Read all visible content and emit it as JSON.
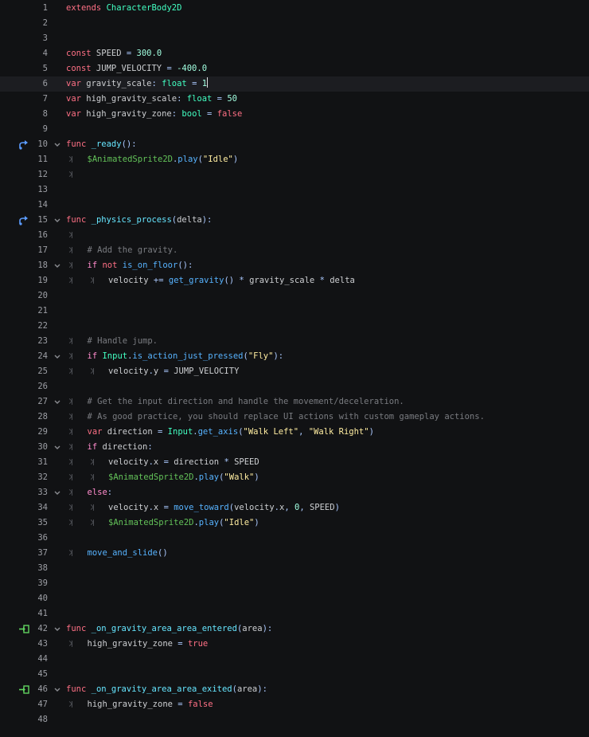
{
  "editor": {
    "line_height": 19,
    "current_line": 6,
    "lines": [
      {
        "n": "1",
        "indent": 0,
        "tokens": [
          [
            "kw",
            "extends"
          ],
          [
            "tx",
            " "
          ],
          [
            "ty",
            "CharacterBody2D"
          ]
        ]
      },
      {
        "n": "2",
        "indent": 0,
        "tokens": []
      },
      {
        "n": "3",
        "indent": 0,
        "tokens": []
      },
      {
        "n": "4",
        "indent": 0,
        "tokens": [
          [
            "kw",
            "const"
          ],
          [
            "tx",
            " SPEED "
          ],
          [
            "sy",
            "="
          ],
          [
            "tx",
            " "
          ],
          [
            "num",
            "300.0"
          ]
        ]
      },
      {
        "n": "5",
        "indent": 0,
        "tokens": [
          [
            "kw",
            "const"
          ],
          [
            "tx",
            " JUMP_VELOCITY "
          ],
          [
            "sy",
            "="
          ],
          [
            "tx",
            " "
          ],
          [
            "num",
            "-400.0"
          ]
        ]
      },
      {
        "n": "6",
        "indent": 0,
        "caret": true,
        "tokens": [
          [
            "kw",
            "var"
          ],
          [
            "tx",
            " gravity_scale"
          ],
          [
            "sy",
            ":"
          ],
          [
            "tx",
            " "
          ],
          [
            "ty",
            "float"
          ],
          [
            "tx",
            " "
          ],
          [
            "sy",
            "="
          ],
          [
            "tx",
            " "
          ],
          [
            "num",
            "1"
          ]
        ]
      },
      {
        "n": "7",
        "indent": 0,
        "tokens": [
          [
            "kw",
            "var"
          ],
          [
            "tx",
            " high_gravity_scale"
          ],
          [
            "sy",
            ":"
          ],
          [
            "tx",
            " "
          ],
          [
            "ty",
            "float"
          ],
          [
            "tx",
            " "
          ],
          [
            "sy",
            "="
          ],
          [
            "tx",
            " "
          ],
          [
            "num",
            "50"
          ]
        ]
      },
      {
        "n": "8",
        "indent": 0,
        "tokens": [
          [
            "kw",
            "var"
          ],
          [
            "tx",
            " high_gravity_zone"
          ],
          [
            "sy",
            ":"
          ],
          [
            "tx",
            " "
          ],
          [
            "ty",
            "bool"
          ],
          [
            "tx",
            " "
          ],
          [
            "sy",
            "="
          ],
          [
            "tx",
            " "
          ],
          [
            "kw",
            "false"
          ]
        ]
      },
      {
        "n": "9",
        "indent": 0,
        "tokens": []
      },
      {
        "n": "10",
        "indent": 0,
        "fold": true,
        "icon": "override-icon",
        "tokens": [
          [
            "kw",
            "func"
          ],
          [
            "tx",
            " "
          ],
          [
            "fd",
            "_ready"
          ],
          [
            "sy",
            "():"
          ]
        ]
      },
      {
        "n": "11",
        "indent": 1,
        "tokens": [
          [
            "nd",
            "$AnimatedSprite2D"
          ],
          [
            "sy",
            "."
          ],
          [
            "fn",
            "play"
          ],
          [
            "sy",
            "("
          ],
          [
            "str",
            "\"Idle\""
          ],
          [
            "sy",
            ")"
          ]
        ]
      },
      {
        "n": "12",
        "indent": 1,
        "tokens": []
      },
      {
        "n": "13",
        "indent": 0,
        "tokens": []
      },
      {
        "n": "14",
        "indent": 0,
        "tokens": []
      },
      {
        "n": "15",
        "indent": 0,
        "fold": true,
        "icon": "override-icon",
        "tokens": [
          [
            "kw",
            "func"
          ],
          [
            "tx",
            " "
          ],
          [
            "fd",
            "_physics_process"
          ],
          [
            "sy",
            "("
          ],
          [
            "tx",
            "delta"
          ],
          [
            "sy",
            "):"
          ]
        ]
      },
      {
        "n": "16",
        "indent": 1,
        "tokens": []
      },
      {
        "n": "17",
        "indent": 1,
        "tokens": [
          [
            "cm",
            "# Add the gravity."
          ]
        ]
      },
      {
        "n": "18",
        "indent": 1,
        "fold": true,
        "tokens": [
          [
            "cf",
            "if"
          ],
          [
            "tx",
            " "
          ],
          [
            "kw",
            "not"
          ],
          [
            "tx",
            " "
          ],
          [
            "fn",
            "is_on_floor"
          ],
          [
            "sy",
            "():"
          ]
        ]
      },
      {
        "n": "19",
        "indent": 2,
        "tokens": [
          [
            "tx",
            "velocity "
          ],
          [
            "sy",
            "+="
          ],
          [
            "tx",
            " "
          ],
          [
            "fn",
            "get_gravity"
          ],
          [
            "sy",
            "()"
          ],
          [
            "tx",
            " "
          ],
          [
            "sy",
            "*"
          ],
          [
            "tx",
            " gravity_scale "
          ],
          [
            "sy",
            "*"
          ],
          [
            "tx",
            " delta"
          ]
        ]
      },
      {
        "n": "20",
        "indent": 0,
        "tokens": []
      },
      {
        "n": "21",
        "indent": 0,
        "tokens": []
      },
      {
        "n": "22",
        "indent": 0,
        "tokens": []
      },
      {
        "n": "23",
        "indent": 1,
        "tokens": [
          [
            "cm",
            "# Handle jump."
          ]
        ]
      },
      {
        "n": "24",
        "indent": 1,
        "fold": true,
        "tokens": [
          [
            "cf",
            "if"
          ],
          [
            "tx",
            " "
          ],
          [
            "ty",
            "Input"
          ],
          [
            "sy",
            "."
          ],
          [
            "fn",
            "is_action_just_pressed"
          ],
          [
            "sy",
            "("
          ],
          [
            "str",
            "\"Fly\""
          ],
          [
            "sy",
            "):"
          ]
        ]
      },
      {
        "n": "25",
        "indent": 2,
        "tokens": [
          [
            "tx",
            "velocity"
          ],
          [
            "sy",
            "."
          ],
          [
            "tx",
            "y "
          ],
          [
            "sy",
            "="
          ],
          [
            "tx",
            " JUMP_VELOCITY"
          ]
        ]
      },
      {
        "n": "26",
        "indent": 0,
        "tokens": []
      },
      {
        "n": "27",
        "indent": 1,
        "fold": true,
        "tokens": [
          [
            "cm",
            "# Get the input direction and handle the movement/deceleration."
          ]
        ]
      },
      {
        "n": "28",
        "indent": 1,
        "tokens": [
          [
            "cm",
            "# As good practice, you should replace UI actions with custom gameplay actions."
          ]
        ]
      },
      {
        "n": "29",
        "indent": 1,
        "tokens": [
          [
            "kw",
            "var"
          ],
          [
            "tx",
            " direction "
          ],
          [
            "sy",
            "="
          ],
          [
            "tx",
            " "
          ],
          [
            "ty",
            "Input"
          ],
          [
            "sy",
            "."
          ],
          [
            "fn",
            "get_axis"
          ],
          [
            "sy",
            "("
          ],
          [
            "str",
            "\"Walk Left\""
          ],
          [
            "sy",
            ","
          ],
          [
            "tx",
            " "
          ],
          [
            "str",
            "\"Walk Right\""
          ],
          [
            "sy",
            ")"
          ]
        ]
      },
      {
        "n": "30",
        "indent": 1,
        "fold": true,
        "tokens": [
          [
            "cf",
            "if"
          ],
          [
            "tx",
            " direction"
          ],
          [
            "sy",
            ":"
          ]
        ]
      },
      {
        "n": "31",
        "indent": 2,
        "tokens": [
          [
            "tx",
            "velocity"
          ],
          [
            "sy",
            "."
          ],
          [
            "tx",
            "x "
          ],
          [
            "sy",
            "="
          ],
          [
            "tx",
            " direction "
          ],
          [
            "sy",
            "*"
          ],
          [
            "tx",
            " SPEED"
          ]
        ]
      },
      {
        "n": "32",
        "indent": 2,
        "tokens": [
          [
            "nd",
            "$AnimatedSprite2D"
          ],
          [
            "sy",
            "."
          ],
          [
            "fn",
            "play"
          ],
          [
            "sy",
            "("
          ],
          [
            "str",
            "\"Walk\""
          ],
          [
            "sy",
            ")"
          ]
        ]
      },
      {
        "n": "33",
        "indent": 1,
        "fold": true,
        "tokens": [
          [
            "cf",
            "else"
          ],
          [
            "sy",
            ":"
          ]
        ]
      },
      {
        "n": "34",
        "indent": 2,
        "tokens": [
          [
            "tx",
            "velocity"
          ],
          [
            "sy",
            "."
          ],
          [
            "tx",
            "x "
          ],
          [
            "sy",
            "="
          ],
          [
            "tx",
            " "
          ],
          [
            "fn",
            "move_toward"
          ],
          [
            "sy",
            "("
          ],
          [
            "tx",
            "velocity"
          ],
          [
            "sy",
            "."
          ],
          [
            "tx",
            "x"
          ],
          [
            "sy",
            ","
          ],
          [
            "tx",
            " "
          ],
          [
            "num",
            "0"
          ],
          [
            "sy",
            ","
          ],
          [
            "tx",
            " SPEED"
          ],
          [
            "sy",
            ")"
          ]
        ]
      },
      {
        "n": "35",
        "indent": 2,
        "tokens": [
          [
            "nd",
            "$AnimatedSprite2D"
          ],
          [
            "sy",
            "."
          ],
          [
            "fn",
            "play"
          ],
          [
            "sy",
            "("
          ],
          [
            "str",
            "\"Idle\""
          ],
          [
            "sy",
            ")"
          ]
        ]
      },
      {
        "n": "36",
        "indent": 0,
        "tokens": []
      },
      {
        "n": "37",
        "indent": 1,
        "tokens": [
          [
            "fn",
            "move_and_slide"
          ],
          [
            "sy",
            "()"
          ]
        ]
      },
      {
        "n": "38",
        "indent": 0,
        "tokens": []
      },
      {
        "n": "39",
        "indent": 0,
        "tokens": []
      },
      {
        "n": "40",
        "indent": 0,
        "tokens": []
      },
      {
        "n": "41",
        "indent": 0,
        "tokens": []
      },
      {
        "n": "42",
        "indent": 0,
        "fold": true,
        "icon": "signal-connection-icon",
        "tokens": [
          [
            "kw",
            "func"
          ],
          [
            "tx",
            " "
          ],
          [
            "fd",
            "_on_gravity_area_area_entered"
          ],
          [
            "sy",
            "("
          ],
          [
            "tx",
            "area"
          ],
          [
            "sy",
            "):"
          ]
        ]
      },
      {
        "n": "43",
        "indent": 1,
        "tokens": [
          [
            "tx",
            "high_gravity_zone "
          ],
          [
            "sy",
            "="
          ],
          [
            "tx",
            " "
          ],
          [
            "kw",
            "true"
          ]
        ]
      },
      {
        "n": "44",
        "indent": 0,
        "tokens": []
      },
      {
        "n": "45",
        "indent": 0,
        "tokens": []
      },
      {
        "n": "46",
        "indent": 0,
        "fold": true,
        "icon": "signal-connection-icon",
        "tokens": [
          [
            "kw",
            "func"
          ],
          [
            "tx",
            " "
          ],
          [
            "fd",
            "_on_gravity_area_area_exited"
          ],
          [
            "sy",
            "("
          ],
          [
            "tx",
            "area"
          ],
          [
            "sy",
            "):"
          ]
        ]
      },
      {
        "n": "47",
        "indent": 1,
        "tokens": [
          [
            "tx",
            "high_gravity_zone "
          ],
          [
            "sy",
            "="
          ],
          [
            "tx",
            " "
          ],
          [
            "kw",
            "false"
          ]
        ]
      },
      {
        "n": "48",
        "indent": 0,
        "tokens": []
      }
    ]
  }
}
